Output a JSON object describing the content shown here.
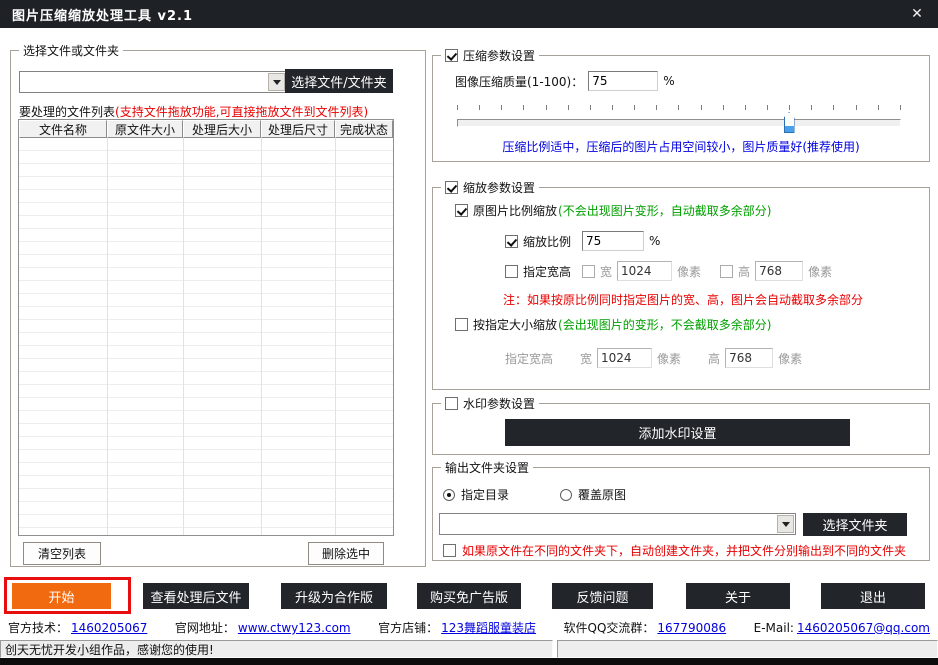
{
  "window": {
    "title": "图片压缩缩放处理工具 v2.1",
    "close_glyph": "✕"
  },
  "file_panel": {
    "legend": "选择文件或文件夹",
    "path_combo_value": "",
    "select_button": "选择文件/文件夹",
    "list_label": "要处理的文件列表",
    "list_hint": "(支持文件拖放功能,可直接拖放文件到文件列表)",
    "columns": [
      "文件名称",
      "原文件大小",
      "处理后大小",
      "处理后尺寸",
      "完成状态"
    ],
    "rows": [],
    "clear_button": "清空列表",
    "delete_button": "删除选中"
  },
  "compress": {
    "legend": "压缩参数设置",
    "enabled": true,
    "quality_label": "图像压缩质量(1-100)：",
    "quality_value": "75",
    "percent_sign": "%",
    "slider_percent": 75,
    "hint": "压缩比例适中，压缩后的图片占用空间较小，图片质量好(推荐使用)"
  },
  "scale": {
    "legend": "缩放参数设置",
    "enabled": true,
    "keep_ratio": {
      "label": "原图片比例缩放",
      "hint": "(不会出现图片变形，自动截取多余部分)",
      "checked": true
    },
    "ratio": {
      "label": "缩放比例",
      "value": "75",
      "percent_sign": "%",
      "checked": true
    },
    "size": {
      "label": "指定宽高",
      "checked": false,
      "width_label": "宽",
      "width_value": "1024",
      "height_label": "高",
      "height_value": "768",
      "px_label": "像素"
    },
    "note": "注：如果按原比例同时指定图片的宽、高，图片会自动截取多余部分",
    "fixed": {
      "label": "按指定大小缩放",
      "hint": "(会出现图片的变形，不会截取多余部分)",
      "checked": false,
      "size_label": "指定宽高",
      "width_label": "宽",
      "width_value": "1024",
      "height_label": "高",
      "height_value": "768",
      "px_label": "像素"
    }
  },
  "watermark": {
    "legend": "水印参数设置",
    "enabled": false,
    "button": "添加水印设置"
  },
  "output": {
    "legend": "输出文件夹设置",
    "radio_dir": {
      "label": "指定目录",
      "selected": true
    },
    "radio_overwrite": {
      "label": "覆盖原图",
      "selected": false
    },
    "folder_combo_value": "",
    "select_button": "选择文件夹",
    "auto_create": {
      "label": "如果原文件在不同的文件夹下，自动创建文件夹，并把文件分别输出到不同的文件夹",
      "checked": false
    }
  },
  "actions": {
    "start": "开始",
    "view_files": "查看处理后文件",
    "upgrade": "升级为合作版",
    "buy_noad": "购买免广告版",
    "feedback": "反馈问题",
    "about": "关于",
    "exit": "退出"
  },
  "footer": {
    "items": [
      {
        "label": "官方技术：",
        "link": "1460205067"
      },
      {
        "label": "官网地址：",
        "link": "www.ctwy123.com"
      },
      {
        "label": "官方店铺：",
        "link": "123舞蹈服童装店"
      },
      {
        "label": "软件QQ交流群：",
        "link": "167790086"
      },
      {
        "label": "E-Mail:",
        "link": "1460205067@qq.com"
      }
    ]
  },
  "statusbar": {
    "message": "创天无忧开发小组作品，感谢您的使用!"
  },
  "colors": {
    "titlebar": "#1e2227",
    "button_dark": "#22262b",
    "accent_orange": "#f26a0f",
    "annotation_red": "#e60e0e",
    "hint_red": "#e80000",
    "hint_green": "#00a000",
    "link_blue": "#0000e0"
  }
}
